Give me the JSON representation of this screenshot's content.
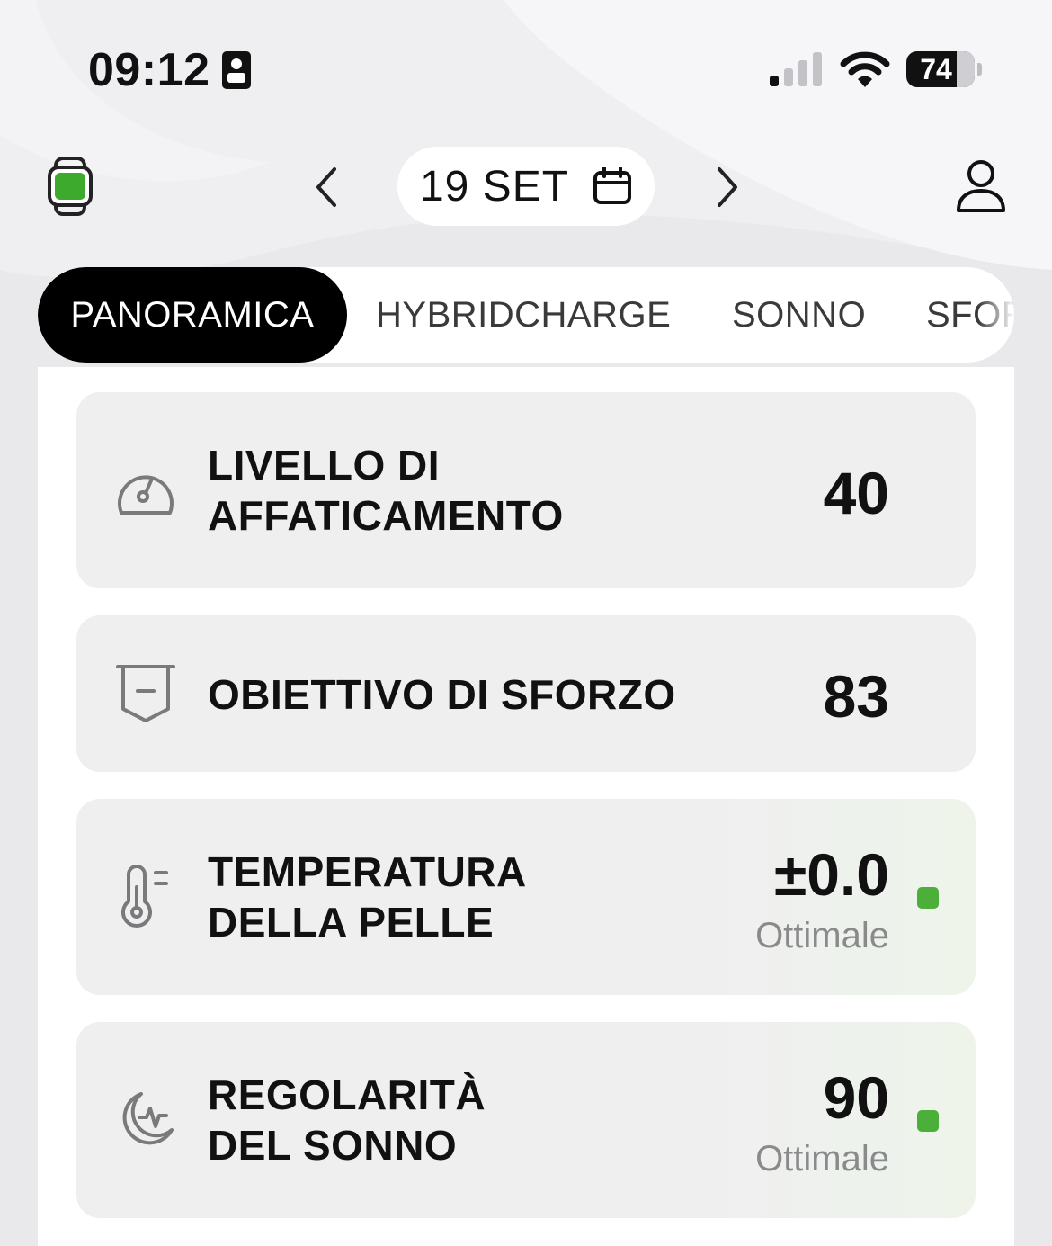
{
  "status_bar": {
    "time": "09:12",
    "battery_level": 74,
    "battery_text": "74"
  },
  "header": {
    "date_label": "19 SET"
  },
  "tabs": [
    {
      "label": "PANORAMICA",
      "active": true
    },
    {
      "label": "HYBRIDCHARGE",
      "active": false
    },
    {
      "label": "SONNO",
      "active": false
    },
    {
      "label": "SFORZO",
      "active": false
    }
  ],
  "metrics": [
    {
      "title_line1": "LIVELLO DI",
      "title_line2": "AFFATICAMENTO",
      "value": "40",
      "status": "",
      "icon": "gauge-icon"
    },
    {
      "title_line1": "OBIETTIVO DI SFORZO",
      "title_line2": "",
      "value": "83",
      "status": "",
      "icon": "shield-target-icon"
    },
    {
      "title_line1": "TEMPERATURA",
      "title_line2": "DELLA PELLE",
      "value": "±0.0",
      "status": "Ottimale",
      "icon": "thermometer-icon"
    },
    {
      "title_line1": "REGOLARITÀ",
      "title_line2": "DEL SONNO",
      "value": "90",
      "status": "Ottimale",
      "icon": "moon-pulse-icon"
    }
  ],
  "colors": {
    "status_good": "#4caf3a",
    "accent": "#000000",
    "watch_green": "#3daa2e"
  }
}
